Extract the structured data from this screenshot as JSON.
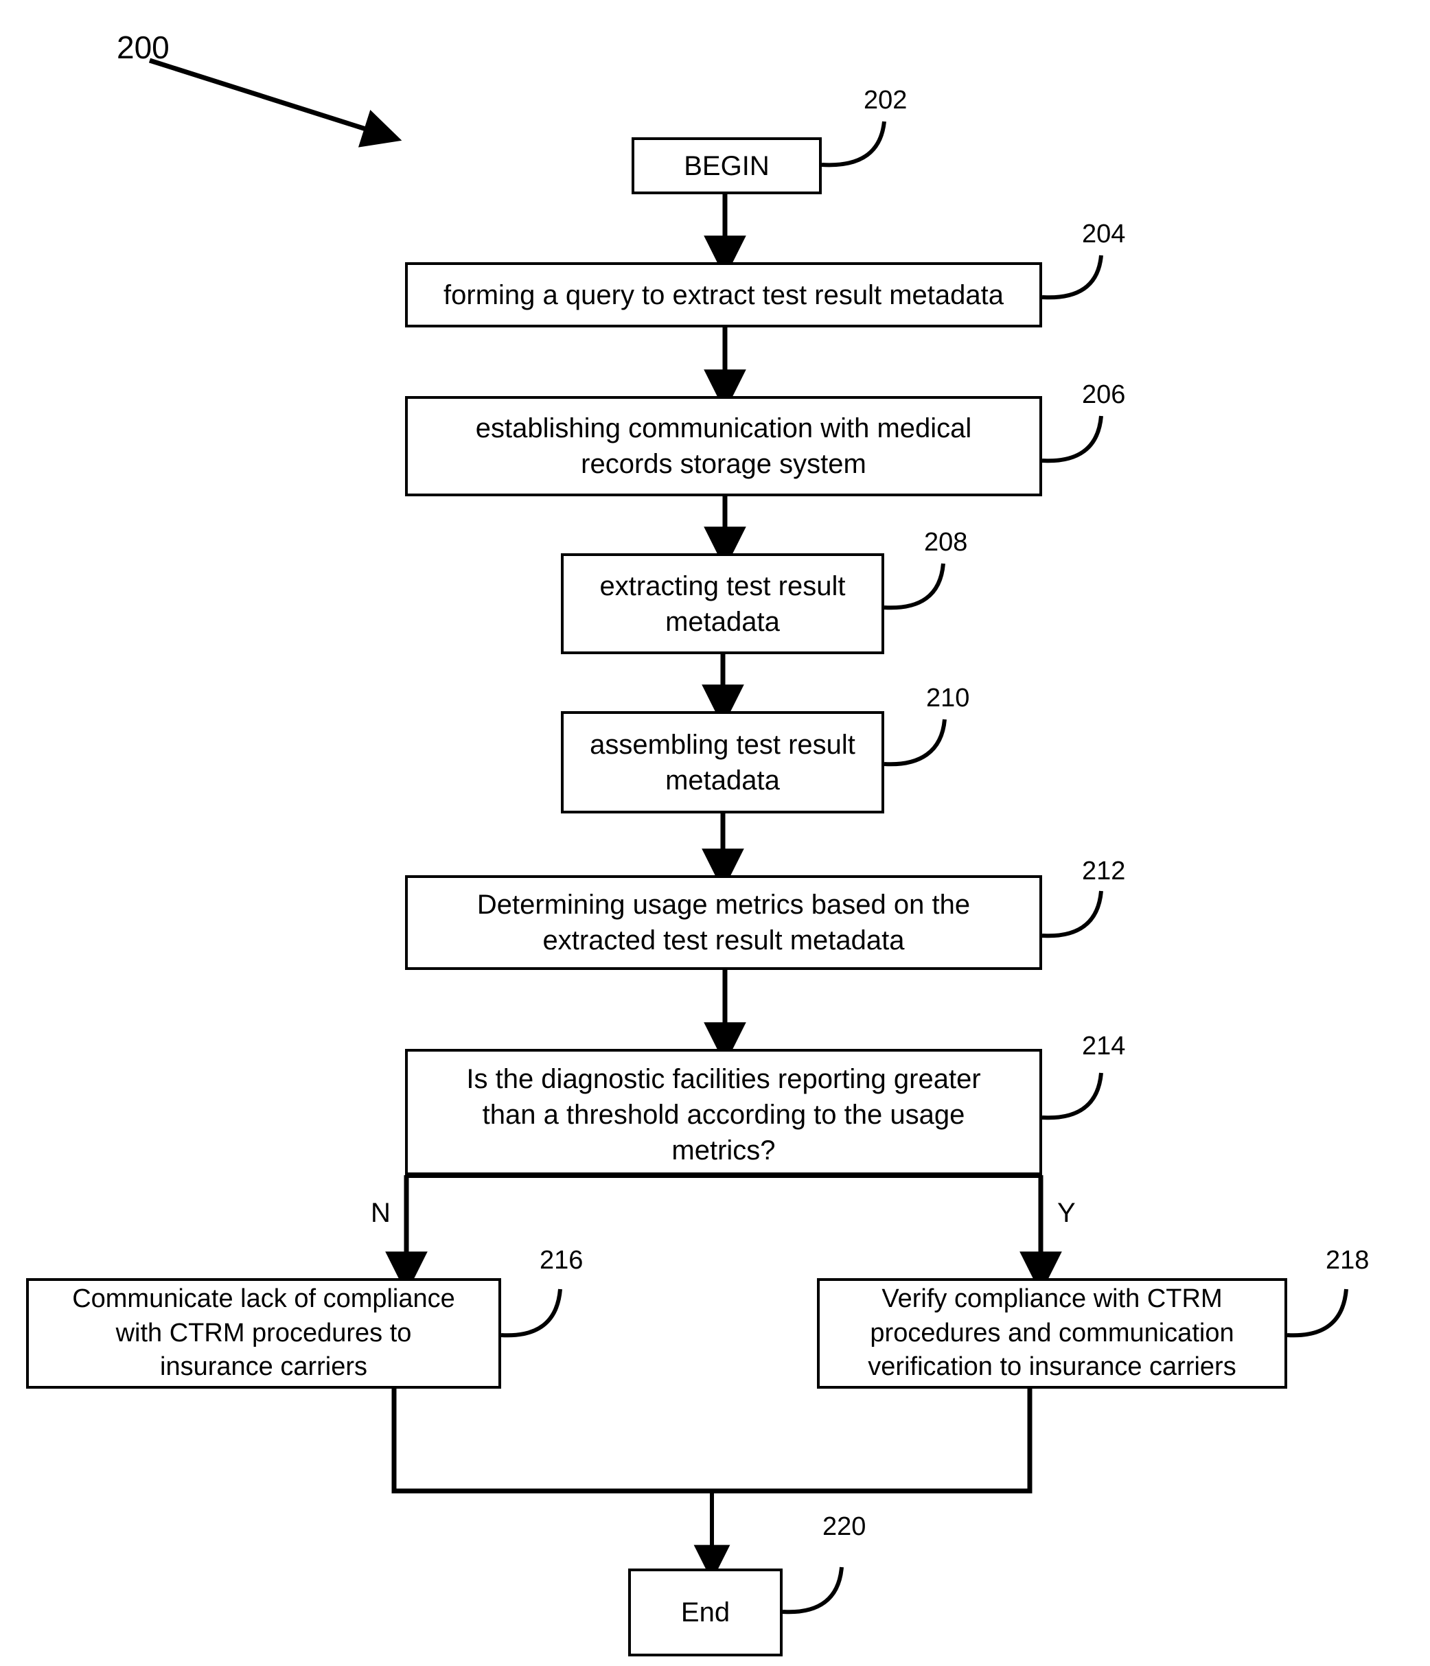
{
  "figure": {
    "number": "200"
  },
  "nodes": {
    "begin": {
      "label": "BEGIN",
      "ref": "202"
    },
    "form_query": {
      "label": "forming a query to extract test result metadata",
      "ref": "204"
    },
    "establish_comm": {
      "label": "establishing communication with medical\nrecords storage system",
      "ref": "206"
    },
    "extract_metadata": {
      "label": "extracting test result\nmetadata",
      "ref": "208"
    },
    "assemble_metadata": {
      "label": "assembling test result\nmetadata",
      "ref": "210"
    },
    "determine_metrics": {
      "label": "Determining usage metrics based on the\nextracted test result metadata",
      "ref": "212"
    },
    "decision": {
      "label": "Is the diagnostic facilities reporting greater\nthan a threshold according to the usage\nmetrics?",
      "ref": "214"
    },
    "communicate_lack": {
      "label": "Communicate lack of compliance\nwith CTRM procedures to\ninsurance carriers",
      "ref": "216"
    },
    "verify_compliance": {
      "label": "Verify compliance with CTRM\nprocedures and communication\nverification to insurance carriers",
      "ref": "218"
    },
    "end": {
      "label": "End",
      "ref": "220"
    }
  },
  "branches": {
    "no": "N",
    "yes": "Y"
  },
  "colors": {
    "stroke": "#000000",
    "fill": "#ffffff",
    "text": "#000000"
  }
}
